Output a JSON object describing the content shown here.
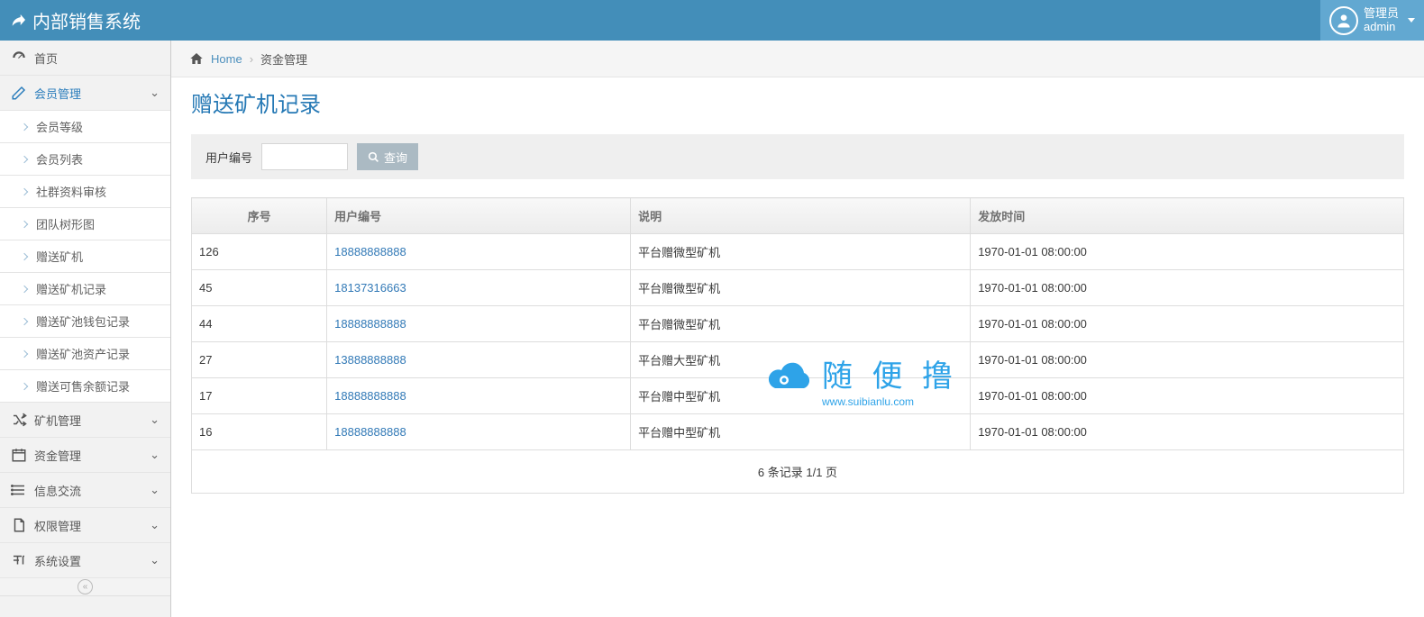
{
  "app_title": "内部销售系统",
  "user": {
    "role": "管理员",
    "name": "admin"
  },
  "sidebar": {
    "home": "首页",
    "member_mgmt": "会员管理",
    "sub": [
      "会员等级",
      "会员列表",
      "社群资料审核",
      "团队树形图",
      "赠送矿机",
      "赠送矿机记录",
      "赠送矿池钱包记录",
      "赠送矿池资产记录",
      "赠送可售余额记录"
    ],
    "miner_mgmt": "矿机管理",
    "fund_mgmt": "资金管理",
    "info_exchange": "信息交流",
    "perm_mgmt": "权限管理",
    "sys_settings": "系统设置"
  },
  "breadcrumb": {
    "home": "Home",
    "current": "资金管理"
  },
  "page_title": "赠送矿机记录",
  "filter": {
    "label": "用户编号",
    "btn": "查询"
  },
  "table": {
    "headers": [
      "序号",
      "用户编号",
      "说明",
      "发放时间"
    ],
    "rows": [
      {
        "sn": "126",
        "uid": "18888888888",
        "desc": "平台赠微型矿机",
        "time": "1970-01-01 08:00:00"
      },
      {
        "sn": "45",
        "uid": "18137316663",
        "desc": "平台赠微型矿机",
        "time": "1970-01-01 08:00:00"
      },
      {
        "sn": "44",
        "uid": "18888888888",
        "desc": "平台赠微型矿机",
        "time": "1970-01-01 08:00:00"
      },
      {
        "sn": "27",
        "uid": "13888888888",
        "desc": "平台赠大型矿机",
        "time": "1970-01-01 08:00:00"
      },
      {
        "sn": "17",
        "uid": "18888888888",
        "desc": "平台赠中型矿机",
        "time": "1970-01-01 08:00:00"
      },
      {
        "sn": "16",
        "uid": "18888888888",
        "desc": "平台赠中型矿机",
        "time": "1970-01-01 08:00:00"
      }
    ],
    "pager": "6 条记录 1/1 页"
  },
  "watermark": {
    "text": "随 便 撸",
    "url": "www.suibianlu.com"
  }
}
